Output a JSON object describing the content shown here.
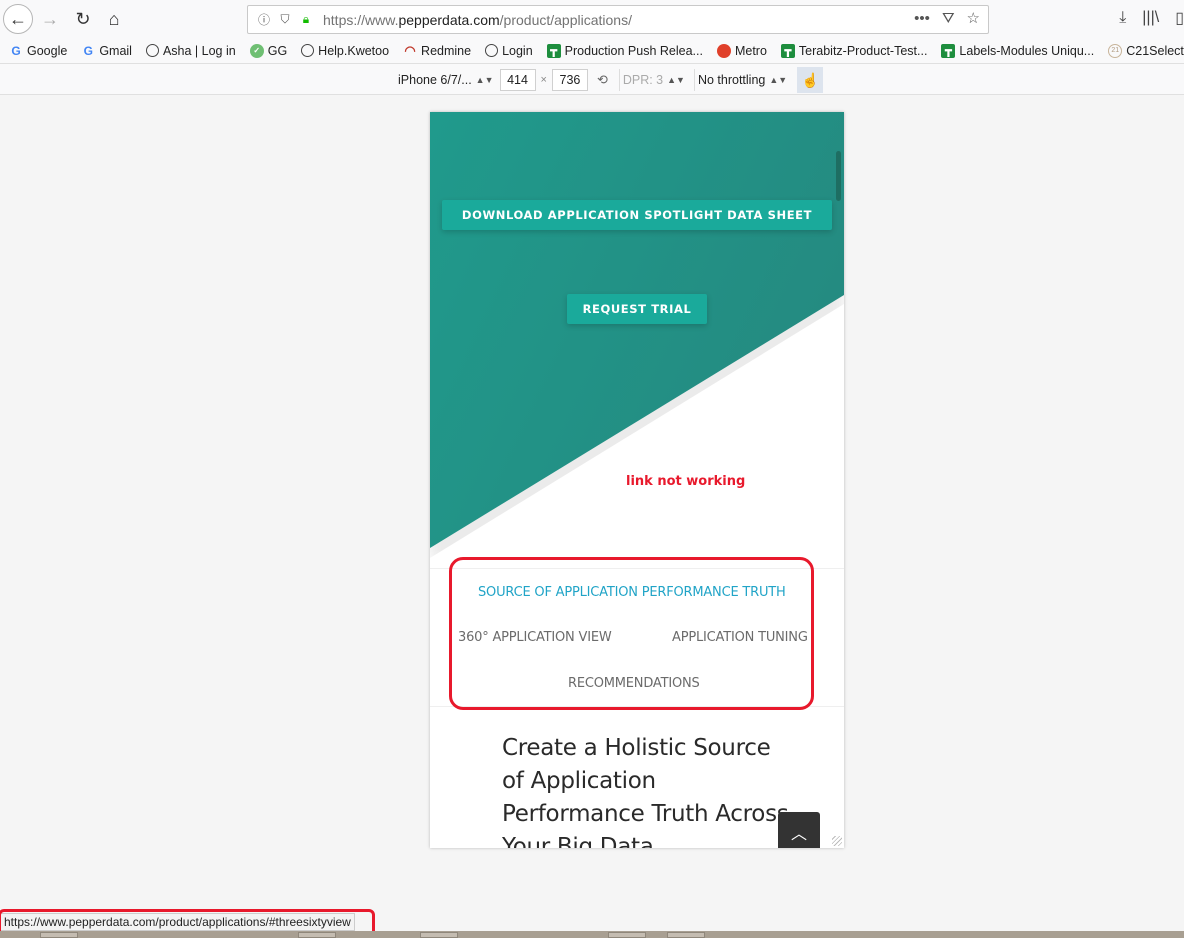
{
  "browser": {
    "url": {
      "prefix": "https://www.",
      "domain": "pepperdata.com",
      "path": "/product/applications/"
    },
    "icons": {
      "back": "arrow-left-icon",
      "forward": "arrow-right-icon",
      "reload": "reload-icon",
      "home": "home-icon",
      "info": "info-icon",
      "tracking": "shield-icon",
      "lock": "lock-icon",
      "more": "ellipsis-icon",
      "pocket": "pocket-icon",
      "bookmark": "star-icon",
      "downloads": "download-icon",
      "library": "library-icon"
    },
    "bookmarks": [
      {
        "label": "Google",
        "icon": "google-icon"
      },
      {
        "label": "Gmail",
        "icon": "google-icon"
      },
      {
        "label": "Asha | Log in",
        "icon": "globe-icon"
      },
      {
        "label": "GG",
        "icon": "gg-icon"
      },
      {
        "label": "Help.Kwetoo",
        "icon": "globe-icon"
      },
      {
        "label": "Redmine",
        "icon": "redmine-icon"
      },
      {
        "label": "Login",
        "icon": "globe-icon"
      },
      {
        "label": "Production Push Relea...",
        "icon": "sheets-icon"
      },
      {
        "label": "Metro",
        "icon": "metro-icon"
      },
      {
        "label": "Terabitz-Product-Test...",
        "icon": "sheets-icon"
      },
      {
        "label": "Labels-Modules Uniqu...",
        "icon": "sheets-icon"
      },
      {
        "label": "C21Select",
        "icon": "c21-icon"
      }
    ]
  },
  "responsive_toolbar": {
    "device": "iPhone 6/7/...",
    "width": "414",
    "times": "×",
    "height": "736",
    "dpr": "DPR: 3",
    "throttling": "No throttling"
  },
  "page": {
    "download_button": "DOWNLOAD APPLICATION SPOTLIGHT DATA SHEET",
    "trial_button": "REQUEST TRIAL",
    "annotation": "link not working",
    "tabs": [
      {
        "label": "SOURCE OF APPLICATION PERFORMANCE TRUTH",
        "active": true
      },
      {
        "label": "360° APPLICATION VIEW",
        "active": false
      },
      {
        "label": "APPLICATION TUNING",
        "active": false
      },
      {
        "label": "RECOMMENDATIONS",
        "active": false
      }
    ],
    "heading": "Create a Holistic Source of Application Performance Truth Across Your Big Data",
    "colors": {
      "teal": "#25877e",
      "button": "#1aaa9b",
      "active_tab": "#21a4c7",
      "annotation_red": "#e8192c"
    }
  },
  "status_bar": {
    "link": "https://www.pepperdata.com/product/applications/#threesixtyview"
  }
}
